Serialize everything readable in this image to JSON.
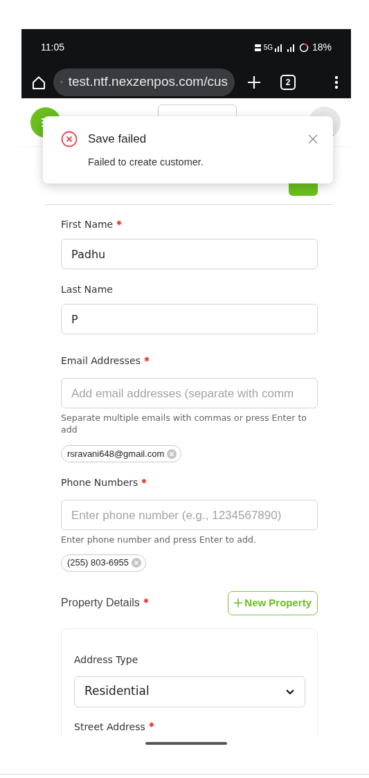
{
  "status_bar": {
    "time": "11:05",
    "network": "5G",
    "battery": "18%"
  },
  "browser": {
    "url": "test.ntf.nexzenpos.com/cus",
    "tab_count": "2"
  },
  "toast": {
    "kind": "error",
    "title": "Save failed",
    "message": "Failed to create customer."
  },
  "fields": [
    {
      "kind": "text",
      "label": "First Name",
      "required": true,
      "value": "Padhu"
    },
    {
      "kind": "text",
      "label": "Last Name",
      "required": false,
      "value": "P"
    },
    {
      "kind": "chips",
      "label": "Email Addresses",
      "required": true,
      "placeholder": "Add email addresses (separate with comm",
      "help": "Separate multiple emails with commas or press Enter to add",
      "chips": [
        "rsravani648@gmail.com"
      ]
    },
    {
      "kind": "chips",
      "label": "Phone Numbers",
      "required": true,
      "placeholder": "Enter phone number (e.g., 1234567890)",
      "help": "Enter phone number and press Enter to add.",
      "chips": [
        "(255) 803-6955"
      ]
    }
  ],
  "property": {
    "label": "Property Details",
    "required": true,
    "button": "New Property",
    "fields": [
      {
        "kind": "select",
        "label": "Address Type",
        "required": false,
        "value": "Residential"
      },
      {
        "kind": "heading",
        "label": "Street Address",
        "required": true
      }
    ]
  }
}
